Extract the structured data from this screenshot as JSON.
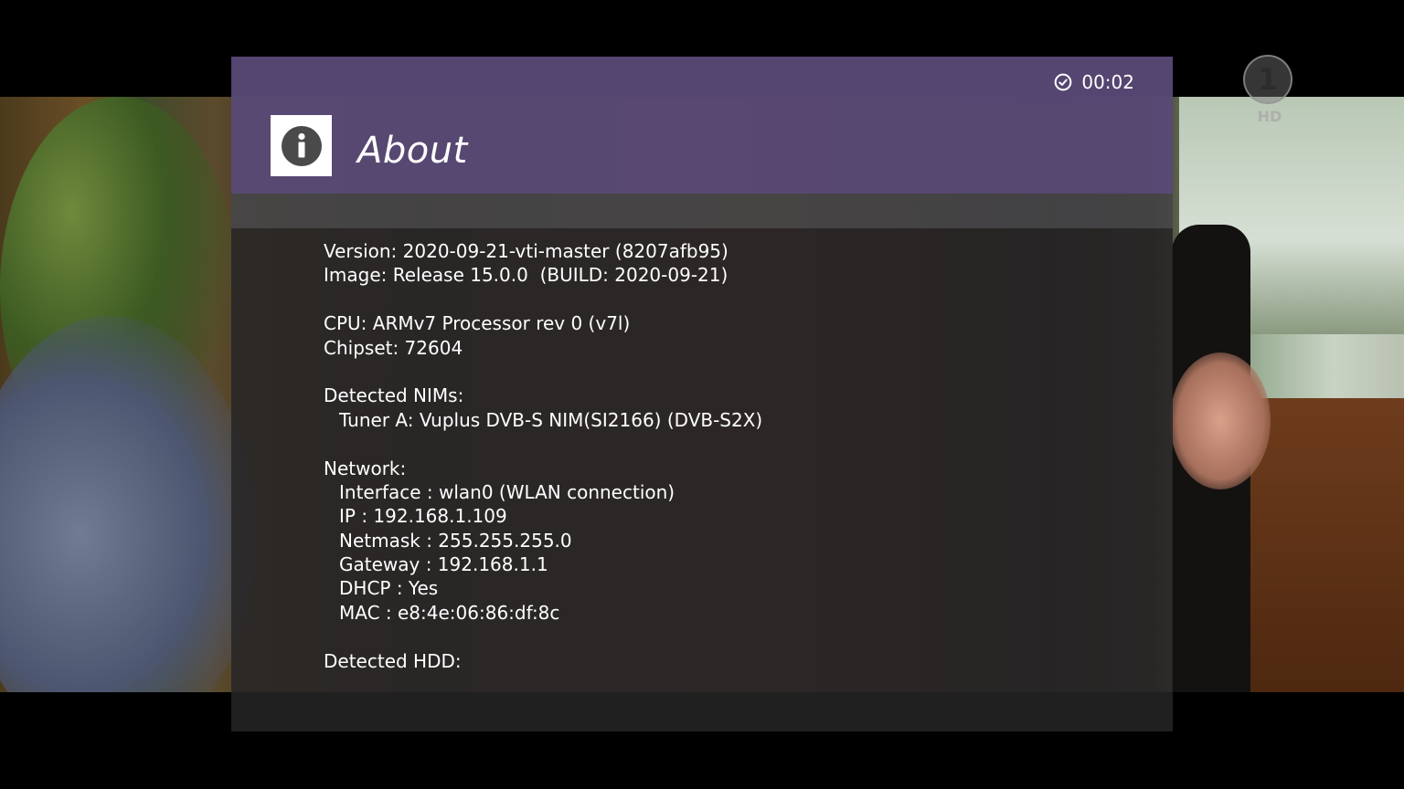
{
  "clock": {
    "time": "00:02",
    "icon": "clock-icon"
  },
  "channel": {
    "logo_icon": "das-erste-logo",
    "logo_number": "1",
    "quality": "HD"
  },
  "dialog": {
    "title": "About",
    "icon": "info-icon",
    "header_color": "#584a76",
    "body_color": "#262526"
  },
  "info": {
    "version": "Version: 2020-09-21-vti-master (8207afb95)",
    "image": "Image: Release 15.0.0  (BUILD: 2020-09-21)",
    "cpu": "CPU: ARMv7 Processor rev 0 (v7l)",
    "chipset": "Chipset: 72604",
    "nims_heading": "Detected NIMs:",
    "nims": [
      "Tuner A: Vuplus DVB-S NIM(SI2166) (DVB-S2X)"
    ],
    "network_heading": "Network:",
    "network": [
      "Interface : wlan0 (WLAN connection)",
      "IP : 192.168.1.109",
      "Netmask : 255.255.255.0",
      "Gateway : 192.168.1.1",
      "DHCP : Yes",
      "MAC : e8:4e:06:86:df:8c"
    ],
    "hdd_heading": "Detected HDD:"
  }
}
